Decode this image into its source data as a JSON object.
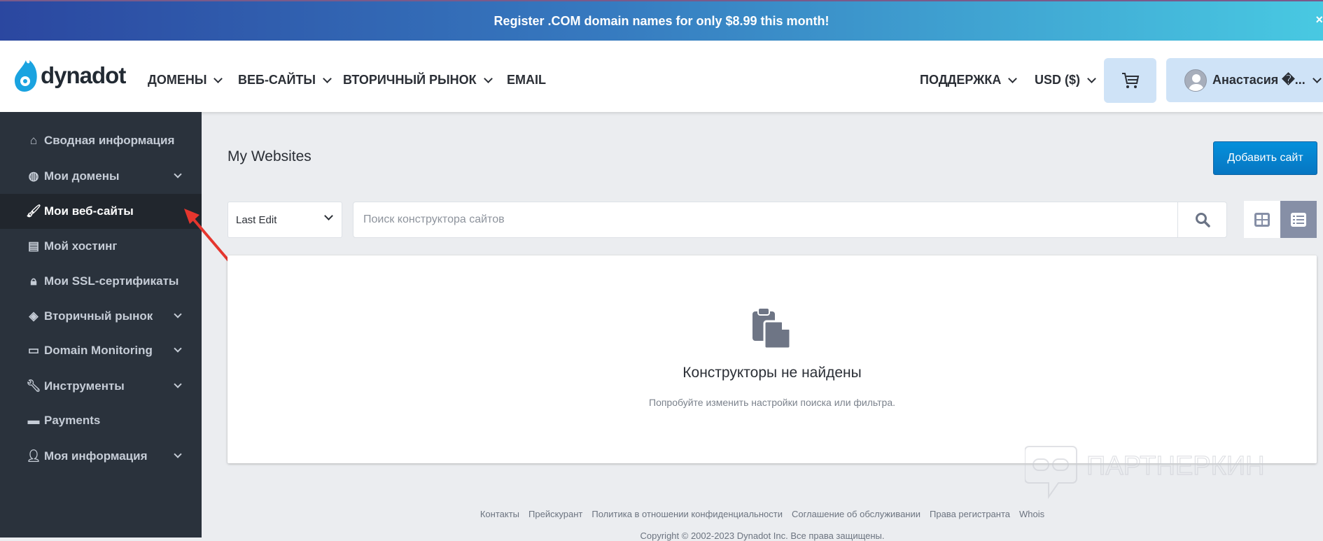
{
  "banner": {
    "text": "Register .COM domain names for only $8.99 this month!",
    "close": "×"
  },
  "header": {
    "logo": "dynadot",
    "nav": [
      "ДОМЕНЫ",
      "ВЕБ-САЙТЫ",
      "ВТОРИЧНЫЙ РЫНОК",
      "EMAIL"
    ],
    "support": "ПОДДЕРЖКА",
    "currency": "USD ($)",
    "user": "Анастасия �..."
  },
  "sidebar": {
    "items": [
      {
        "label": "Сводная информация",
        "icon": "home-icon"
      },
      {
        "label": "Мои домены",
        "icon": "globe-icon"
      },
      {
        "label": "Мои веб-сайты",
        "icon": "paintbrush-icon"
      },
      {
        "label": "Мой хостинг",
        "icon": "server-icon"
      },
      {
        "label": "Мои SSL-сертификаты",
        "icon": "lock-icon"
      },
      {
        "label": "Вторичный рынок",
        "icon": "tags-icon"
      },
      {
        "label": "Domain Monitoring",
        "icon": "laptop-icon"
      },
      {
        "label": "Инструменты",
        "icon": "wrench-icon"
      },
      {
        "label": "Payments",
        "icon": "wallet-icon"
      },
      {
        "label": "Моя информация",
        "icon": "user-icon"
      }
    ]
  },
  "main": {
    "title": "My Websites",
    "add_button": "Добавить сайт",
    "sort_value": "Last Edit",
    "search_placeholder": "Поиск конструктора сайтов",
    "empty_title": "Конструкторы не найдены",
    "empty_subtitle": "Попробуйте изменить настройки поиска или фильтра."
  },
  "footer": {
    "links": [
      "Контакты",
      "Прейскурант",
      "Политика в отношении конфиденциальности",
      "Соглашение об обслуживании",
      "Права регистранта",
      "Whois"
    ],
    "copyright": "Copyright © 2002-2023 Dynadot Inc. Все права защищены."
  },
  "watermark": "ПАРТНЕРКИН",
  "colors": {
    "accent": "#0684cf",
    "sidebar": "#2a323c",
    "active": "#21262d"
  }
}
